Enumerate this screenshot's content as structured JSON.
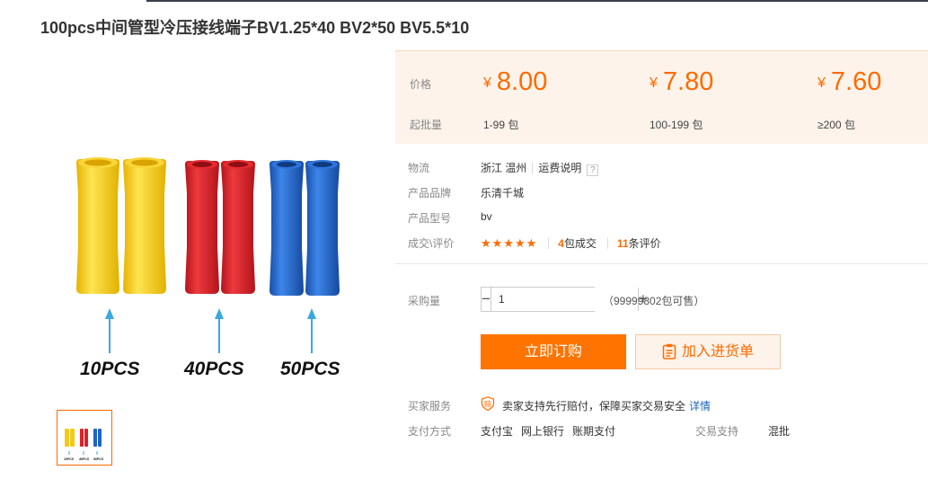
{
  "product": {
    "title": "100pcs中间管型冷压接线端子BV1.25*40 BV2*50 BV5.5*10",
    "image_labels": [
      "10PCS",
      "40PCS",
      "50PCS"
    ]
  },
  "price_box": {
    "price_label": "价格",
    "batch_label": "起批量",
    "currency_symbol": "¥",
    "tiers": [
      {
        "price": "8.00",
        "range": "1-99 包"
      },
      {
        "price": "7.80",
        "range": "100-199 包"
      },
      {
        "price": "7.60",
        "range": "≥200 包"
      }
    ]
  },
  "attributes": {
    "logistics_label": "物流",
    "location": "浙江 温州",
    "shipping_info": "运费说明",
    "help_glyph": "?",
    "brand_label": "产品品牌",
    "brand": "乐清千城",
    "model_label": "产品型号",
    "model": "bv",
    "deal_label": "成交\\评价",
    "stars": "★★★★★",
    "rating": 5,
    "deals_count": "4",
    "deals_suffix": "包成交",
    "reviews_count": "11",
    "reviews_suffix": "条评价"
  },
  "purchase": {
    "qty_label": "采购量",
    "minus": "−",
    "plus": "+",
    "qty_value": "1",
    "stock_text": "（99999802包可售）"
  },
  "buttons": {
    "buy_now": "立即订购",
    "add_to_cart": "加入进货单"
  },
  "service": {
    "label": "买家服务",
    "badge_glyph": "赔",
    "text": "卖家支持先行赔付，保障买家交易安全",
    "detail_link": "详情"
  },
  "payment": {
    "label": "支付方式",
    "methods": [
      "支付宝",
      "网上银行",
      "账期支付"
    ],
    "trade_label": "交易支持",
    "trade_value": "混批"
  },
  "colors": {
    "accent": "#ff6a00",
    "buy_button": "#ff7300",
    "price_bg": "#fdf3ea",
    "connector_yellow": "#f3c91c",
    "connector_red": "#d8232a",
    "connector_blue": "#1f63c7",
    "arrow": "#3aa8e0"
  }
}
